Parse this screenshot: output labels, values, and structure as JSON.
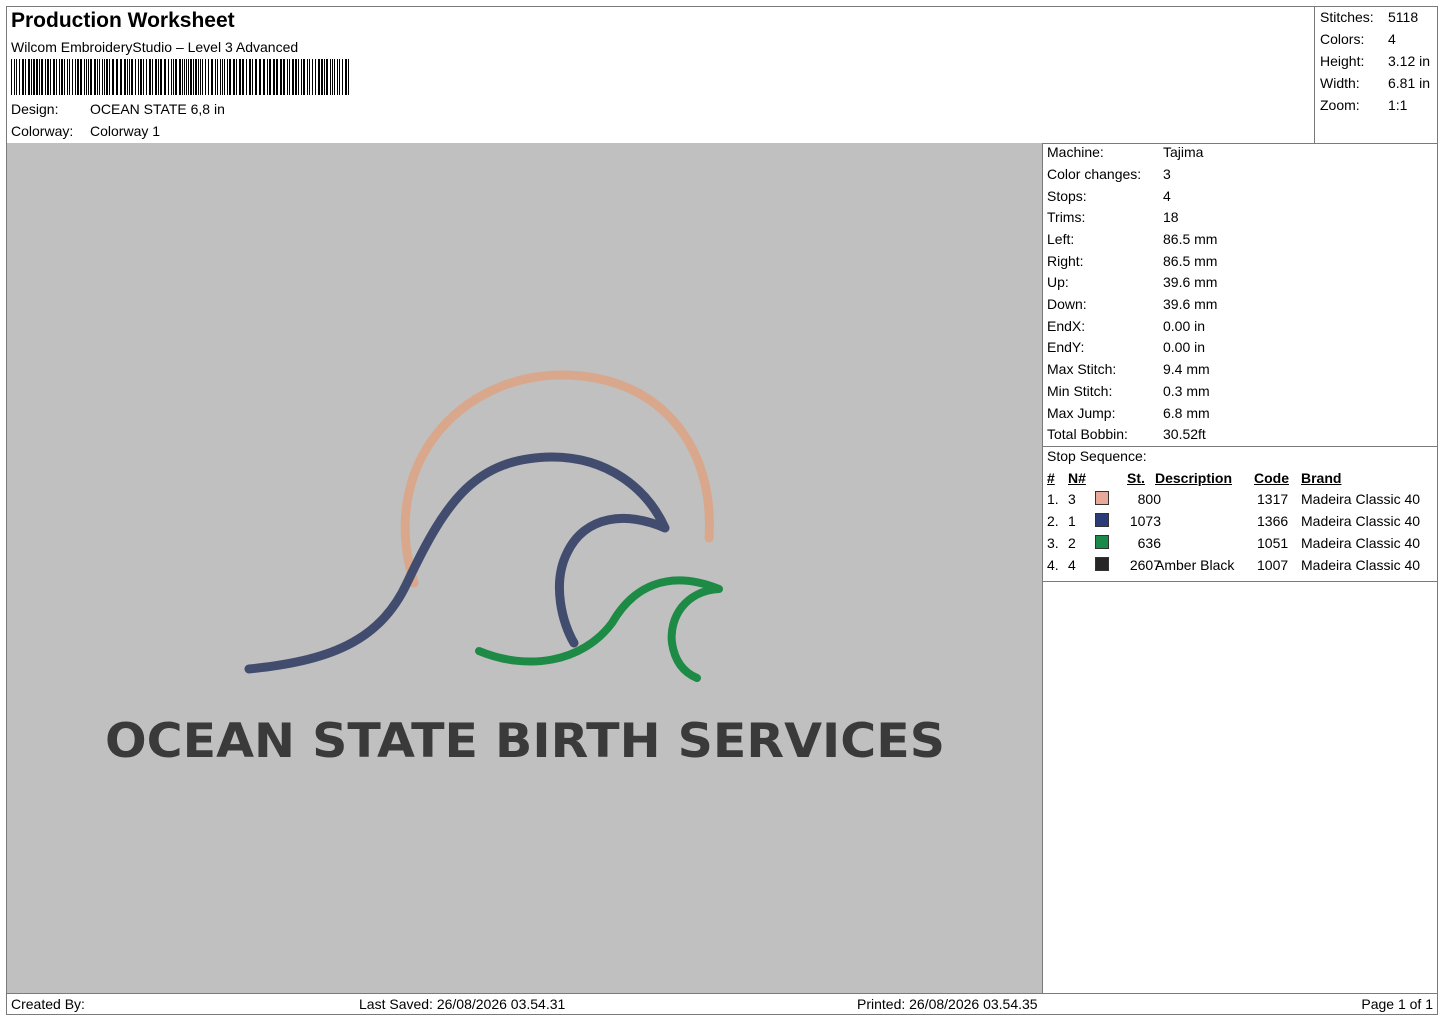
{
  "header": {
    "title": "Production Worksheet",
    "subtitle": "Wilcom EmbroideryStudio – Level 3 Advanced",
    "design_label": "Design:",
    "design_value": "OCEAN STATE 6,8 in",
    "colorway_label": "Colorway:",
    "colorway_value": "Colorway 1"
  },
  "summary": [
    {
      "label": "Stitches:",
      "value": "5118"
    },
    {
      "label": "Colors:",
      "value": "4"
    },
    {
      "label": "Height:",
      "value": "3.12 in"
    },
    {
      "label": "Width:",
      "value": "6.81 in"
    },
    {
      "label": "Zoom:",
      "value": "1:1"
    }
  ],
  "machine_info": [
    {
      "label": "Machine:",
      "value": "Tajima"
    },
    {
      "label": "Color changes:",
      "value": "3"
    },
    {
      "label": "Stops:",
      "value": "4"
    },
    {
      "label": "Trims:",
      "value": "18"
    },
    {
      "label": "Left:",
      "value": "86.5 mm"
    },
    {
      "label": "Right:",
      "value": "86.5 mm"
    },
    {
      "label": "Up:",
      "value": "39.6 mm"
    },
    {
      "label": "Down:",
      "value": "39.6 mm"
    },
    {
      "label": "EndX:",
      "value": "0.00 in"
    },
    {
      "label": "EndY:",
      "value": "0.00 in"
    },
    {
      "label": "Max Stitch:",
      "value": "9.4 mm"
    },
    {
      "label": "Min Stitch:",
      "value": "0.3 mm"
    },
    {
      "label": "Max Jump:",
      "value": "6.8 mm"
    },
    {
      "label": "Total Bobbin:",
      "value": "30.52ft"
    }
  ],
  "stop_sequence": {
    "heading": "Stop Sequence:",
    "columns": {
      "num": "#",
      "needle": "N#",
      "stitches": "St.",
      "description": "Description",
      "code": "Code",
      "brand": "Brand"
    },
    "rows": [
      {
        "num": "1.",
        "needle": "3",
        "color": "#e8a89a",
        "stitches": "800",
        "description": "",
        "code": "1317",
        "brand": "Madeira Classic 40"
      },
      {
        "num": "2.",
        "needle": "1",
        "color": "#2b3a78",
        "stitches": "1073",
        "description": "",
        "code": "1366",
        "brand": "Madeira Classic 40"
      },
      {
        "num": "3.",
        "needle": "2",
        "color": "#1a8a4a",
        "stitches": "636",
        "description": "",
        "code": "1051",
        "brand": "Madeira Classic 40"
      },
      {
        "num": "4.",
        "needle": "4",
        "color": "#262626",
        "stitches": "2607",
        "description": "Amber Black",
        "code": "1007",
        "brand": "Madeira Classic 40"
      }
    ]
  },
  "design_preview": {
    "text": "OCEAN STATE BIRTH SERVICES",
    "background": "#c0c0c0",
    "sun_color": "#d9a88c",
    "wave_color": "#424c6e",
    "small_wave_color": "#1d8b46",
    "text_color": "#3a3a3a"
  },
  "footer": {
    "created_by": "Created By:",
    "last_saved": "Last Saved: 26/08/2026 03.54.31",
    "printed": "Printed: 26/08/2026 03.54.35",
    "page": "Page 1 of 1"
  }
}
